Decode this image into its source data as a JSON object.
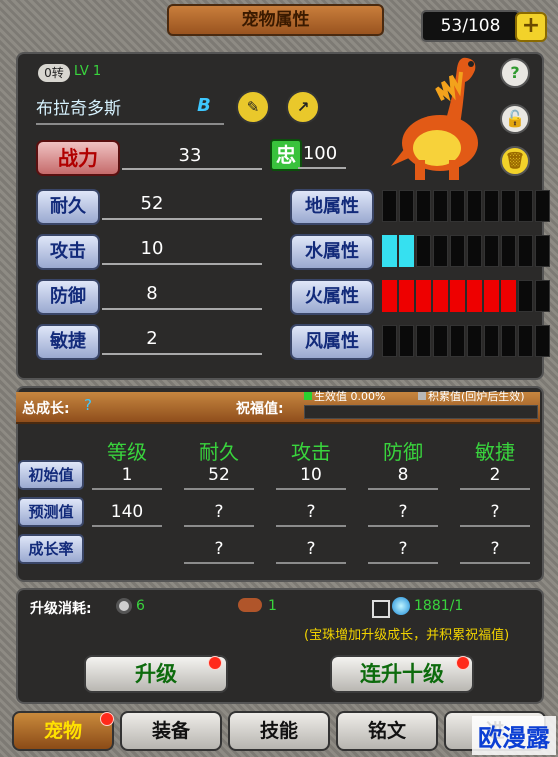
{
  "header": {
    "title": "宠物属性",
    "count": "53/108",
    "add_button": "+"
  },
  "pet": {
    "rebirth": "0转",
    "level": "LV 1",
    "name": "布拉奇多斯",
    "name_badge": "B",
    "power_label": "战力",
    "power_value": "33",
    "loyalty_label": "忠",
    "loyalty_value": "100",
    "stats": [
      {
        "label": "耐久",
        "value": "52"
      },
      {
        "label": "攻击",
        "value": "10"
      },
      {
        "label": "防御",
        "value": "8"
      },
      {
        "label": "敏捷",
        "value": "2"
      }
    ],
    "elements": [
      {
        "label": "地属性",
        "fill": 0,
        "color": "#000000"
      },
      {
        "label": "水属性",
        "fill": 0.2,
        "color": "#36e0f0"
      },
      {
        "label": "火属性",
        "fill": 0.8,
        "color": "#ee0000"
      },
      {
        "label": "风属性",
        "fill": 0,
        "color": "#000000"
      }
    ],
    "side_icons": [
      "help-icon",
      "unlock-icon",
      "trash-icon"
    ],
    "edit_icons": [
      "edit-icon",
      "share-icon"
    ]
  },
  "growth": {
    "total_label": "总成长:",
    "total_value": "?",
    "bless_label": "祝福值:",
    "legend_green": "生效值 0.00%",
    "legend_gray": "积累值(回炉后生效)",
    "columns": [
      "等级",
      "耐久",
      "攻击",
      "防御",
      "敏捷"
    ],
    "rows": [
      {
        "label": "初始值",
        "cells": [
          "1",
          "52",
          "10",
          "8",
          "2"
        ]
      },
      {
        "label": "预测值",
        "cells": [
          "140",
          "?",
          "?",
          "?",
          "?"
        ]
      },
      {
        "label": "成长率",
        "cells": [
          "",
          "?",
          "?",
          "?",
          "?"
        ]
      }
    ]
  },
  "upgrade": {
    "cost_label": "升级消耗:",
    "cost_items": [
      {
        "icon": "gear-icon",
        "value": "6"
      },
      {
        "icon": "meat-icon",
        "value": "1"
      },
      {
        "icon": "gem-icon",
        "value": "1881/1"
      }
    ],
    "hint": "(宝珠增加升级成长，并积累祝福值)",
    "upgrade_btn": "升级",
    "upgrade10_btn": "连升十级"
  },
  "tabs": [
    "宠物",
    "装备",
    "技能",
    "铭文",
    "进"
  ],
  "watermark": "欧漫露"
}
